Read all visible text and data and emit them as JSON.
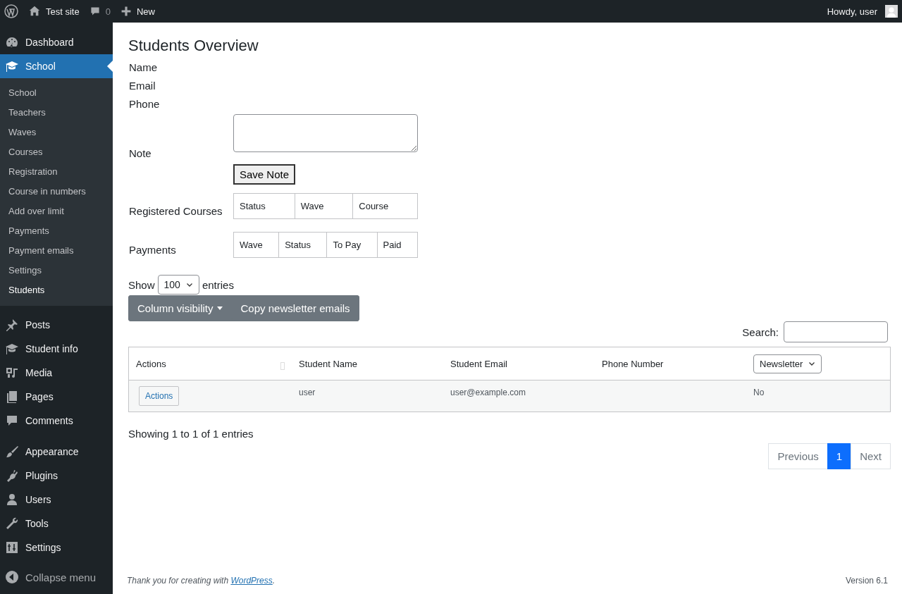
{
  "admin_bar": {
    "site": "Test site",
    "comments": "0",
    "new": "New",
    "greeting": "Howdy, user"
  },
  "sidebar": {
    "groups": [
      {
        "items": [
          {
            "label": "Dashboard",
            "selected": false
          },
          {
            "label": "School",
            "selected": true,
            "children": [
              {
                "label": "School",
                "selected": false
              },
              {
                "label": "Teachers",
                "selected": false
              },
              {
                "label": "Waves",
                "selected": false
              },
              {
                "label": "Courses",
                "selected": false
              },
              {
                "label": "Registration",
                "selected": false
              },
              {
                "label": "Course in numbers",
                "selected": false
              },
              {
                "label": "Add over limit",
                "selected": false
              },
              {
                "label": "Payments",
                "selected": false
              },
              {
                "label": "Payment emails",
                "selected": false
              },
              {
                "label": "Settings",
                "selected": false
              },
              {
                "label": "Students",
                "selected": true
              }
            ]
          }
        ]
      },
      {
        "items": [
          {
            "label": "Posts",
            "selected": false
          },
          {
            "label": "Student info",
            "selected": false
          },
          {
            "label": "Media",
            "selected": false
          },
          {
            "label": "Pages",
            "selected": false
          },
          {
            "label": "Comments",
            "selected": false
          }
        ]
      },
      {
        "items": [
          {
            "label": "Appearance",
            "selected": false
          },
          {
            "label": "Plugins",
            "selected": false
          },
          {
            "label": "Users",
            "selected": false
          },
          {
            "label": "Tools",
            "selected": false
          },
          {
            "label": "Settings",
            "selected": false
          }
        ]
      }
    ],
    "collapse": "Collapse menu"
  },
  "page": {
    "title": "Students Overview",
    "form": [
      {
        "kind": "text",
        "label": "Name"
      },
      {
        "kind": "text",
        "label": "Email"
      },
      {
        "kind": "text",
        "label": "Phone"
      },
      {
        "kind": "note",
        "label": "Note",
        "button": "Save Note"
      },
      {
        "kind": "table",
        "label": "Registered Courses",
        "columns": [
          "Status",
          "Wave",
          "Course"
        ]
      },
      {
        "kind": "table",
        "label": "Payments",
        "columns": [
          "Wave",
          "Status",
          "To Pay",
          "Paid"
        ]
      }
    ],
    "length": {
      "before": "Show",
      "value": "100",
      "after": "entries"
    },
    "buttons": [
      {
        "label": "Column visibility",
        "kind": "dropdown"
      },
      {
        "label": "Copy newsletter emails",
        "kind": "plain"
      }
    ],
    "search": {
      "label": "Search:"
    },
    "table": {
      "columns": [
        {
          "label": "Actions",
          "kind": "sortable"
        },
        {
          "label": "Student Name",
          "kind": "plain"
        },
        {
          "label": "Student Email",
          "kind": "plain"
        },
        {
          "label": "Phone Number",
          "kind": "plain"
        },
        {
          "label": "Newsletter",
          "kind": "select"
        }
      ],
      "rows": [
        {
          "cells": [
            {
              "kind": "button",
              "text": "Actions"
            },
            {
              "kind": "text",
              "text": "user"
            },
            {
              "kind": "text",
              "text": "user@example.com"
            },
            {
              "kind": "empty"
            },
            {
              "kind": "text",
              "text": "No"
            }
          ]
        }
      ]
    },
    "info": "Showing 1 to 1 of 1 entries",
    "pagination": [
      {
        "label": "Previous",
        "selected": false,
        "disabled": true
      },
      {
        "label": "1",
        "selected": true,
        "disabled": false
      },
      {
        "label": "Next",
        "selected": false,
        "disabled": true
      }
    ]
  },
  "footer": {
    "text": "Thank you for creating with ",
    "link": "WordPress",
    "end": ".",
    "version": "Version 6.1"
  }
}
